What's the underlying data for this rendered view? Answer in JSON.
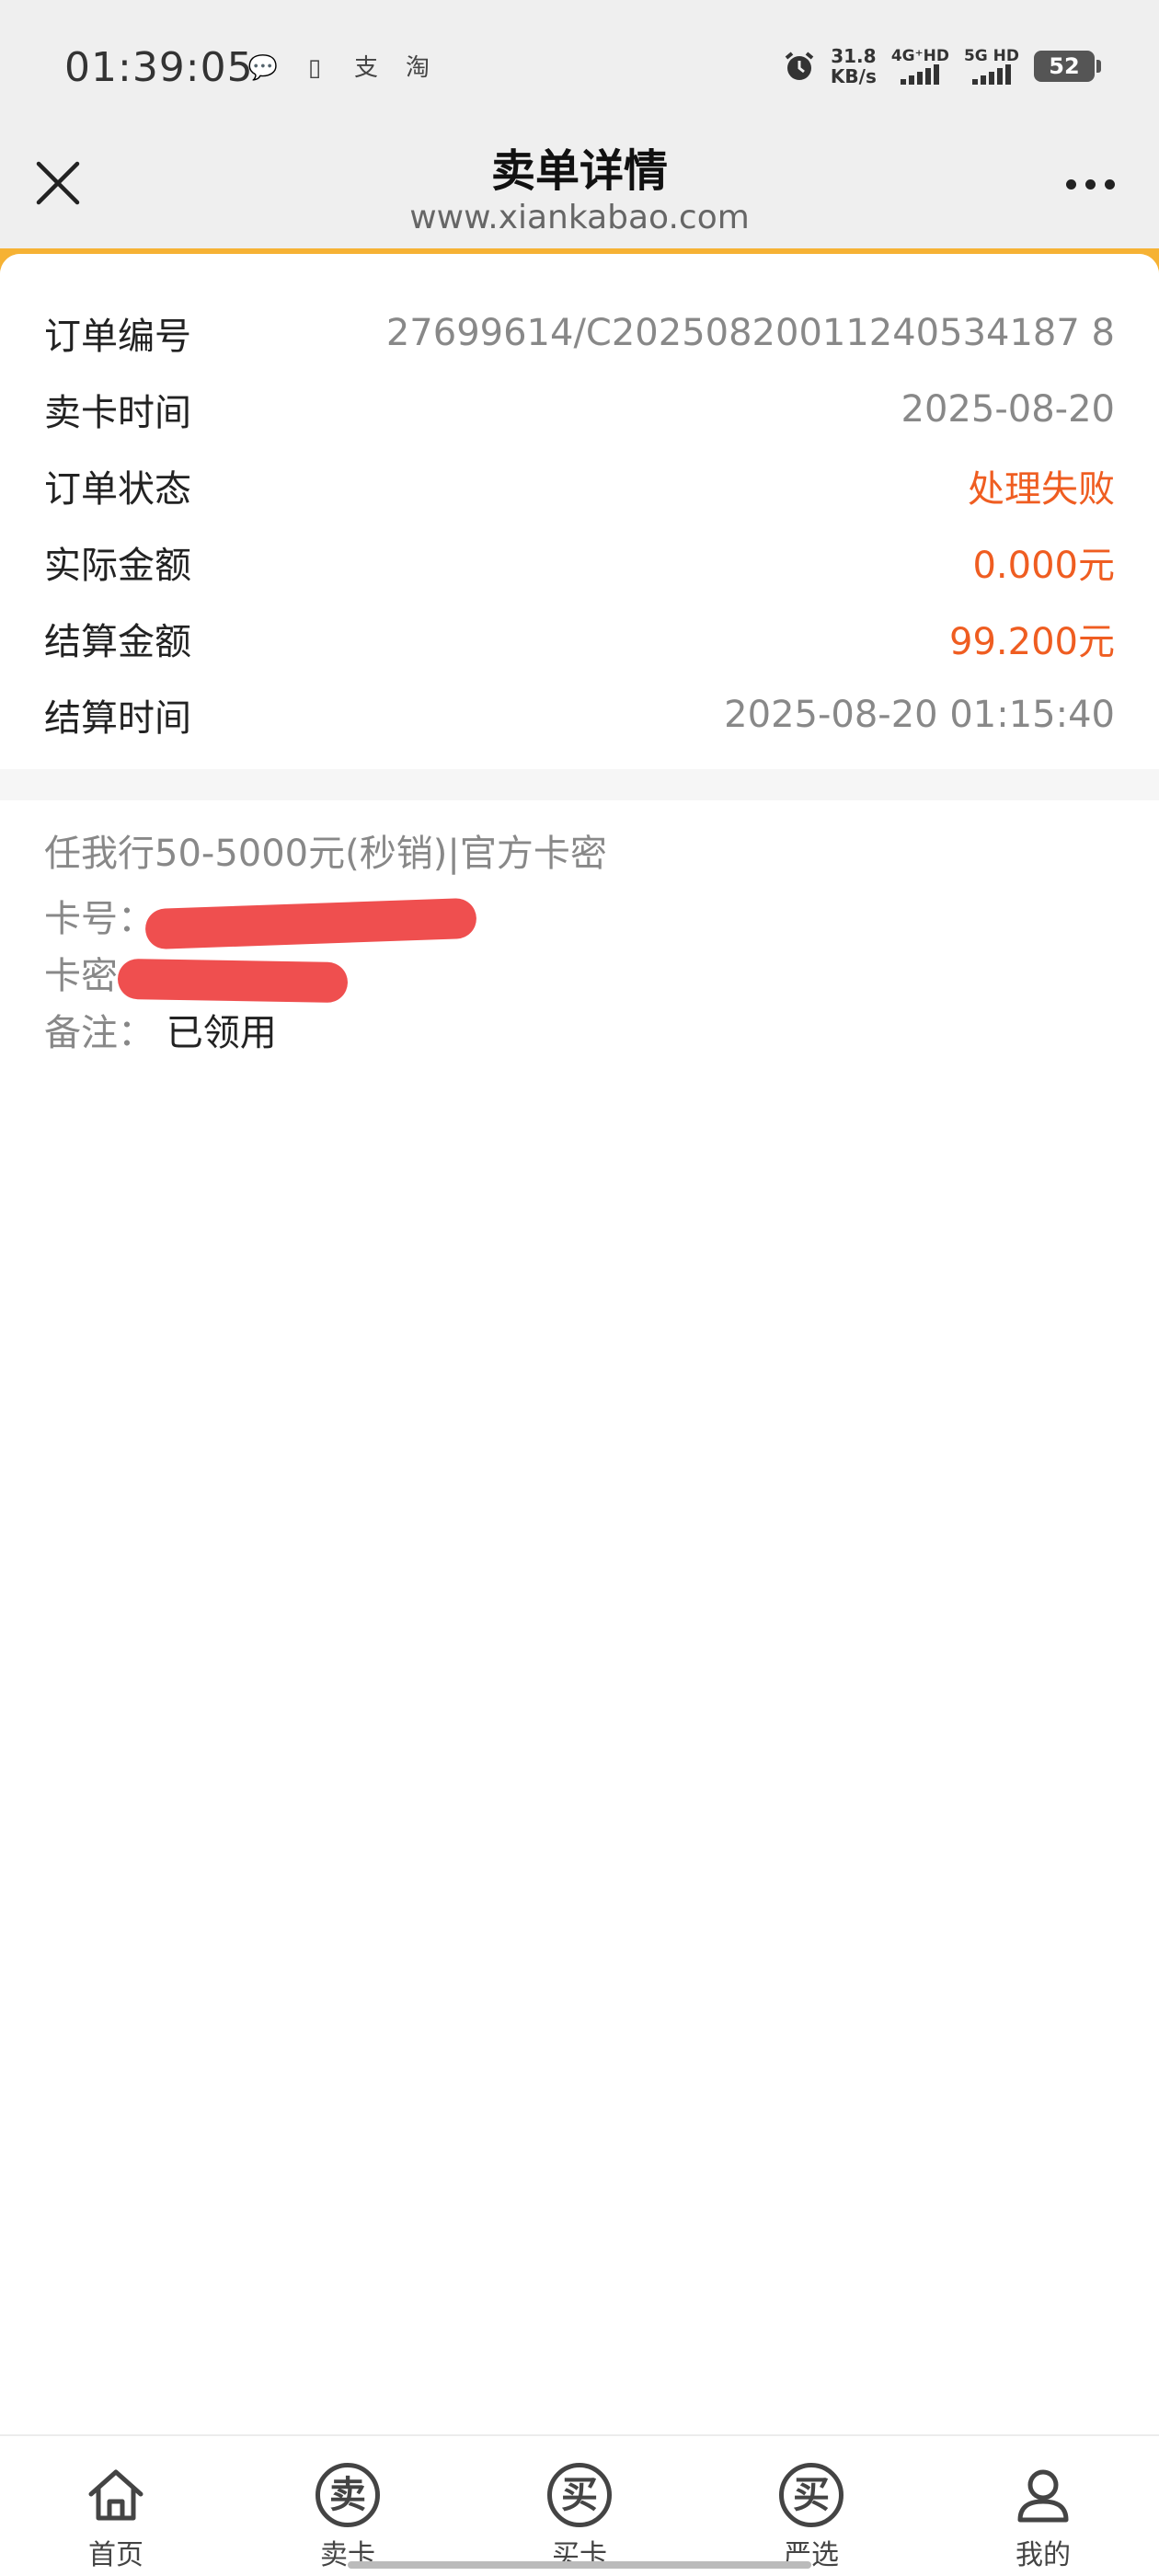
{
  "status": {
    "time": "01:39:05",
    "left_icons": [
      "chat-bubble-icon",
      "document-icon",
      "alipay-icon",
      "taobao-icon"
    ],
    "left_icon_glyphs": [
      "💬",
      "▯",
      "支",
      "淘"
    ],
    "net_speed_value": "31.8",
    "net_speed_unit": "KB/s",
    "signal1_label": "4G⁺HD",
    "signal2_label": "5G HD",
    "battery": "52"
  },
  "header": {
    "title": "卖单详情",
    "subtitle": "www.xiankabao.com"
  },
  "details": [
    {
      "label": "订单编号",
      "value": "27699614/C20250820011240534187 8",
      "style": "normal"
    },
    {
      "label": "卖卡时间",
      "value": "2025-08-20",
      "style": "normal"
    },
    {
      "label": "订单状态",
      "value": "处理失败",
      "style": "alert"
    },
    {
      "label": "实际金额",
      "value": "0.000元",
      "style": "alert"
    },
    {
      "label": "结算金额",
      "value": "99.200元",
      "style": "alert"
    },
    {
      "label": "结算时间",
      "value": "2025-08-20 01:15:40",
      "style": "normal"
    }
  ],
  "card_info": {
    "title": "任我行50-5000元(秒销)|官方卡密",
    "card_number_label": "卡号：",
    "card_secret_label": "卡密",
    "remark_label": "备注：",
    "remark_value": "已领用"
  },
  "nav": [
    {
      "label": "首页",
      "icon": "home-icon",
      "glyph": ""
    },
    {
      "label": "卖卡",
      "icon": "sell-card-icon",
      "glyph": "卖"
    },
    {
      "label": "买卡",
      "icon": "buy-card-icon",
      "glyph": "买"
    },
    {
      "label": "严选",
      "icon": "selected-icon",
      "glyph": "买"
    },
    {
      "label": "我的",
      "icon": "profile-icon",
      "glyph": ""
    }
  ],
  "colors": {
    "accent": "#f6b234",
    "alert": "#ef5d21",
    "redaction": "#ef4f4f"
  }
}
